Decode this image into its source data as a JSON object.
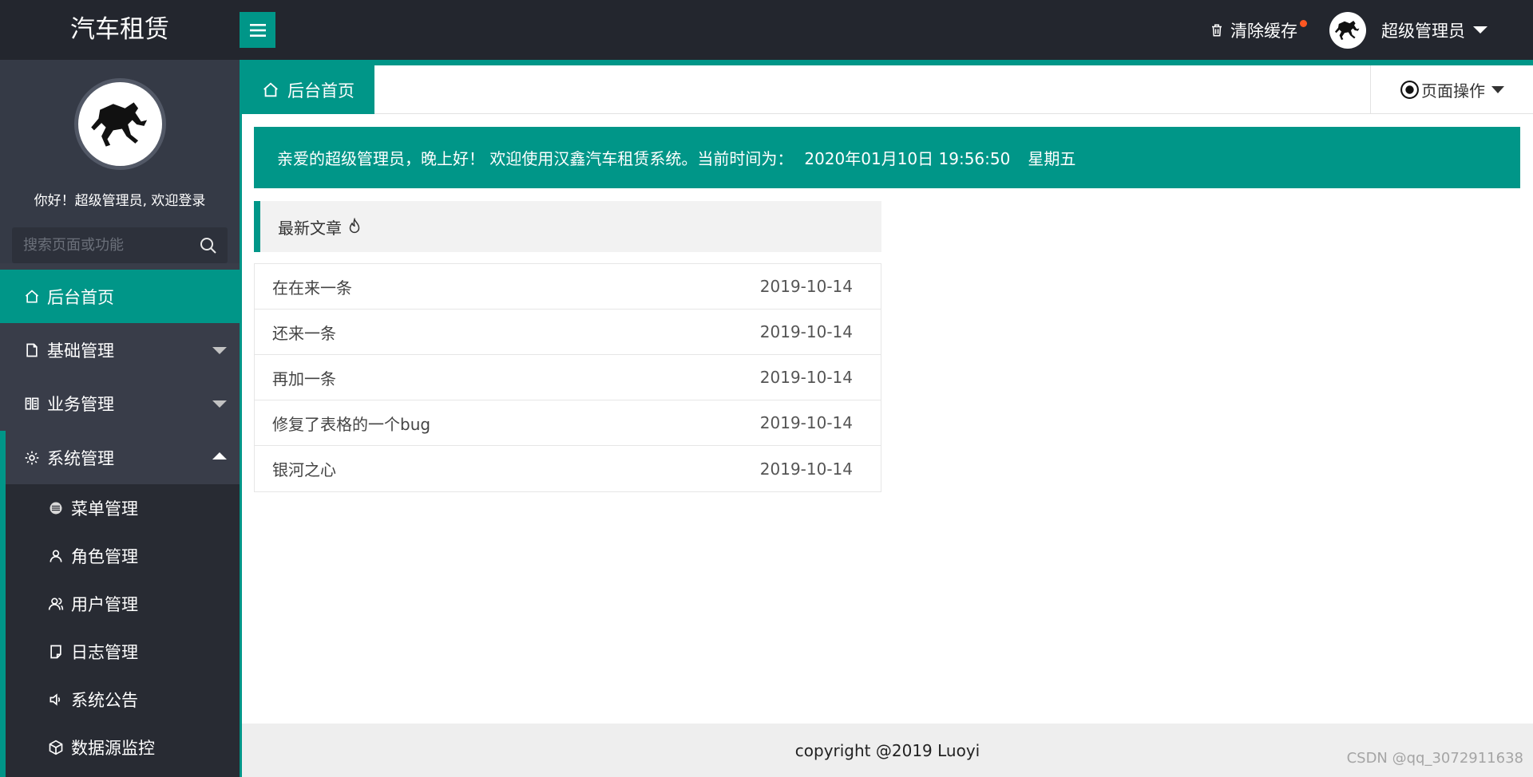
{
  "header": {
    "logo": "汽车租赁",
    "clear_cache": "清除缓存",
    "user_name": "超级管理员"
  },
  "sidebar": {
    "welcome": "你好！超级管理员, 欢迎登录",
    "search_placeholder": "搜索页面或功能",
    "items": [
      {
        "label": "后台首页",
        "icon": "home-icon"
      },
      {
        "label": "基础管理",
        "icon": "file-icon"
      },
      {
        "label": "业务管理",
        "icon": "business-icon"
      },
      {
        "label": "系统管理",
        "icon": "gear-icon"
      }
    ],
    "sub_items": [
      {
        "label": "菜单管理",
        "icon": "menu-circle-icon"
      },
      {
        "label": "角色管理",
        "icon": "user-icon"
      },
      {
        "label": "用户管理",
        "icon": "users-icon"
      },
      {
        "label": "日志管理",
        "icon": "log-icon"
      },
      {
        "label": "系统公告",
        "icon": "speaker-icon"
      },
      {
        "label": "数据源监控",
        "icon": "cube-icon"
      }
    ]
  },
  "tabs": {
    "home": "后台首页",
    "page_ops": "页面操作"
  },
  "banner": {
    "greeting": "亲爱的超级管理员，晚上好！ 欢迎使用汉鑫汽车租赁系统。当前时间为：",
    "datetime": "2020年01月10日 19:56:50",
    "weekday": "星期五"
  },
  "articles": {
    "title": "最新文章",
    "items": [
      {
        "title": "在在来一条",
        "date": "2019-10-14"
      },
      {
        "title": "还来一条",
        "date": "2019-10-14"
      },
      {
        "title": "再加一条",
        "date": "2019-10-14"
      },
      {
        "title": "修复了表格的一个bug",
        "date": "2019-10-14"
      },
      {
        "title": "银河之心",
        "date": "2019-10-14"
      }
    ]
  },
  "footer": "copyright @2019 Luoyi",
  "watermark": "CSDN @qq_3072911638",
  "colors": {
    "accent": "#009688",
    "topbar": "#23262e",
    "sidebar": "#393d49",
    "badge": "#ff5722"
  }
}
